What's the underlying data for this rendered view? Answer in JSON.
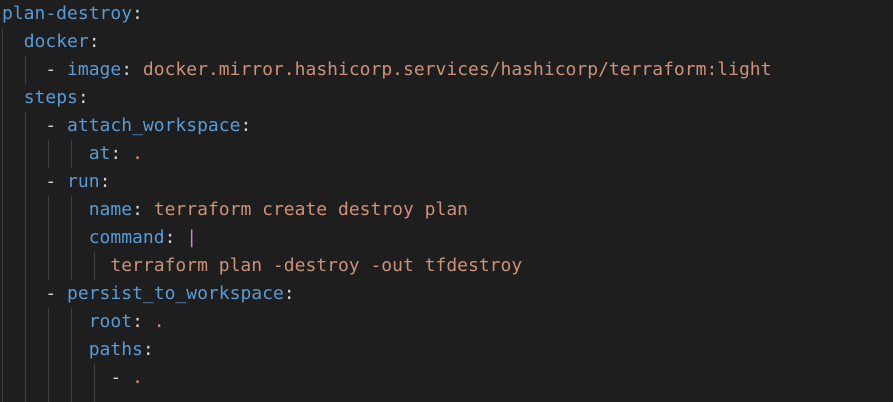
{
  "editor": {
    "colors": {
      "background": "#1e1e1e",
      "key": "#569cd6",
      "string": "#ce9178",
      "punctuation": "#d4d4d4",
      "block_indicator": "#c586c0",
      "indent_guide": "#404040"
    },
    "lines": [
      {
        "key": "plan-destroy",
        "sep": ":"
      },
      {
        "key": "docker",
        "sep": ":"
      },
      {
        "dash": "- ",
        "key": "image",
        "sep": ": ",
        "value": "docker.mirror.hashicorp.services/hashicorp/terraform:light"
      },
      {
        "key": "steps",
        "sep": ":"
      },
      {
        "dash": "- ",
        "key": "attach_workspace",
        "sep": ":"
      },
      {
        "key": "at",
        "sep": ": ",
        "value": "."
      },
      {
        "dash": "- ",
        "key": "run",
        "sep": ":"
      },
      {
        "key": "name",
        "sep": ": ",
        "value": "terraform create destroy plan"
      },
      {
        "key": "command",
        "sep": ": ",
        "block": "|"
      },
      {
        "value": "terraform plan -destroy -out tfdestroy"
      },
      {
        "dash": "- ",
        "key": "persist_to_workspace",
        "sep": ":"
      },
      {
        "key": "root",
        "sep": ": ",
        "value": "."
      },
      {
        "key": "paths",
        "sep": ":"
      },
      {
        "dash": "- ",
        "value": "."
      }
    ]
  }
}
